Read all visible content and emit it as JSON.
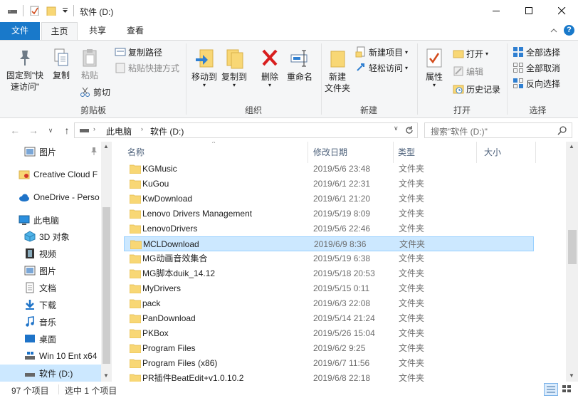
{
  "window": {
    "title": "软件 (D:)",
    "minimize_icon": "minimize-icon",
    "maximize_icon": "maximize-icon",
    "close_icon": "close-icon"
  },
  "tabs": {
    "file": "文件",
    "home": "主页",
    "share": "共享",
    "view": "查看"
  },
  "ribbon": {
    "clipboard": {
      "pin": "固定到\"快速访问\"",
      "pin_line1": "固定到\"快",
      "pin_line2": "速访问\"",
      "copy": "复制",
      "paste": "粘贴",
      "copy_path": "复制路径",
      "paste_shortcut": "粘贴快捷方式",
      "cut": "剪切",
      "label": "剪贴板"
    },
    "organize": {
      "move_to": "移动到",
      "copy_to": "复制到",
      "delete": "删除",
      "rename": "重命名",
      "label": "组织"
    },
    "new": {
      "new_folder_line1": "新建",
      "new_folder_line2": "文件夹",
      "new_item": "新建项目",
      "easy_access": "轻松访问",
      "label": "新建"
    },
    "open": {
      "properties": "属性",
      "open": "打开",
      "edit": "编辑",
      "history": "历史记录",
      "label": "打开"
    },
    "select": {
      "select_all": "全部选择",
      "select_none": "全部取消",
      "invert": "反向选择",
      "label": "选择"
    }
  },
  "address": {
    "crumb1": "此电脑",
    "crumb2": "软件 (D:)",
    "search_placeholder": "搜索\"软件 (D:)\""
  },
  "nav": {
    "items": [
      {
        "label": "图片",
        "icon": "pictures-icon"
      },
      {
        "label": "Creative Cloud F",
        "icon": "creative-cloud-icon"
      },
      {
        "label": "OneDrive - Perso",
        "icon": "onedrive-icon"
      },
      {
        "label": "此电脑",
        "icon": "this-pc-icon"
      },
      {
        "label": "3D 对象",
        "icon": "3d-objects-icon"
      },
      {
        "label": "视频",
        "icon": "videos-icon"
      },
      {
        "label": "图片",
        "icon": "pictures-icon"
      },
      {
        "label": "文档",
        "icon": "documents-icon"
      },
      {
        "label": "下载",
        "icon": "downloads-icon"
      },
      {
        "label": "音乐",
        "icon": "music-icon"
      },
      {
        "label": "桌面",
        "icon": "desktop-icon"
      },
      {
        "label": "Win 10 Ent x64",
        "icon": "drive-icon"
      },
      {
        "label": "软件 (D:)",
        "icon": "drive-icon"
      }
    ]
  },
  "columns": {
    "name": "名称",
    "date": "修改日期",
    "type": "类型",
    "size": "大小"
  },
  "files": [
    {
      "name": "KGMusic",
      "date": "2019/5/6 23:48",
      "type": "文件夹"
    },
    {
      "name": "KuGou",
      "date": "2019/6/1 22:31",
      "type": "文件夹"
    },
    {
      "name": "KwDownload",
      "date": "2019/6/1 21:20",
      "type": "文件夹"
    },
    {
      "name": "Lenovo Drivers Management",
      "date": "2019/5/19 8:09",
      "type": "文件夹"
    },
    {
      "name": "LenovoDrivers",
      "date": "2019/5/6 22:46",
      "type": "文件夹"
    },
    {
      "name": "MCLDownload",
      "date": "2019/6/9 8:36",
      "type": "文件夹"
    },
    {
      "name": "MG动画音效集合",
      "date": "2019/5/19 6:38",
      "type": "文件夹"
    },
    {
      "name": "MG脚本duik_14.12",
      "date": "2019/5/18 20:53",
      "type": "文件夹"
    },
    {
      "name": "MyDrivers",
      "date": "2019/5/15 0:11",
      "type": "文件夹"
    },
    {
      "name": "pack",
      "date": "2019/6/3 22:08",
      "type": "文件夹"
    },
    {
      "name": "PanDownload",
      "date": "2019/5/14 21:24",
      "type": "文件夹"
    },
    {
      "name": "PKBox",
      "date": "2019/5/26 15:04",
      "type": "文件夹"
    },
    {
      "name": "Program Files",
      "date": "2019/6/2 9:25",
      "type": "文件夹"
    },
    {
      "name": "Program Files (x86)",
      "date": "2019/6/7 11:56",
      "type": "文件夹"
    },
    {
      "name": "PR插件BeatEdit+v1.0.10.2",
      "date": "2019/6/8 22:18",
      "type": "文件夹"
    }
  ],
  "status": {
    "count": "97 个项目",
    "selected": "选中 1 个项目"
  },
  "colors": {
    "file_tab": "#1979ca",
    "selection": "#cce8ff",
    "folder": "#f8d775"
  }
}
